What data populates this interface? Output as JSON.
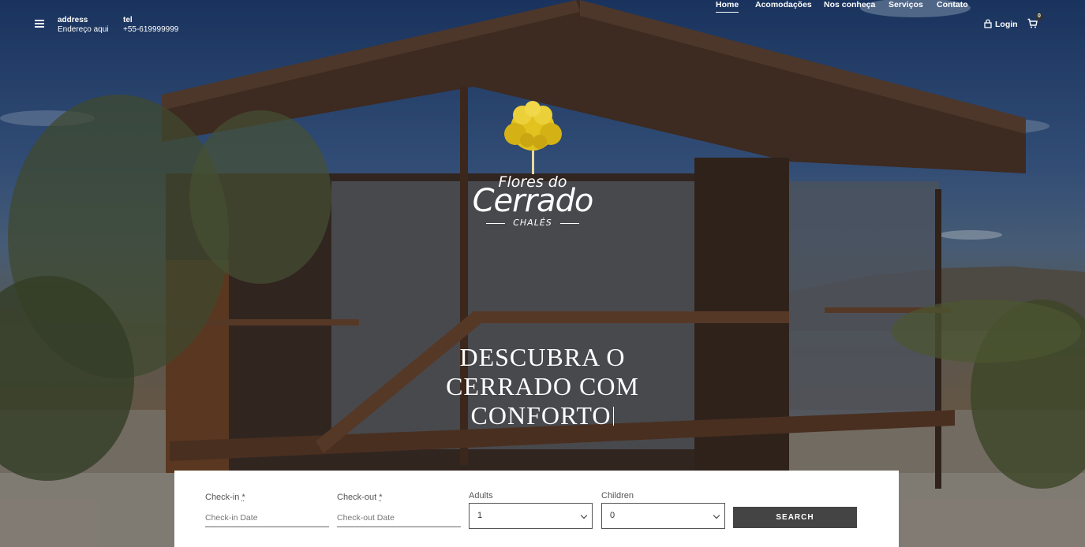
{
  "header": {
    "address_label": "address",
    "address_value": "Endereço aqui",
    "tel_label": "tel",
    "tel_value": "+55-619999999",
    "nav": [
      "Home",
      "Acomodações",
      "Nos conheça",
      "Serviços",
      "Contato"
    ],
    "active_nav": "Home",
    "login_label": "Login",
    "cart_count": "0"
  },
  "logo": {
    "line1": "Flores do",
    "line2": "Cerrado",
    "line3": "CHALÉS"
  },
  "hero": {
    "headline_line1": "DESCUBRA O",
    "headline_line2": "CERRADO COM",
    "headline_line3": "CONFORTO"
  },
  "booking": {
    "checkin_label": "Check-in",
    "checkin_placeholder": "Check-in Date",
    "checkout_label": "Check-out",
    "checkout_placeholder": "Check-out Date",
    "required_mark": "*",
    "adults_label": "Adults",
    "adults_value": "1",
    "children_label": "Children",
    "children_value": "0",
    "search_label": "SEARCH"
  },
  "colors": {
    "accent_yellow": "#e2c21e",
    "button_dark": "#444444"
  }
}
